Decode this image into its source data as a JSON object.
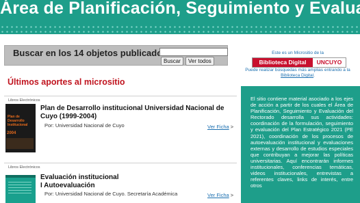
{
  "banner": {
    "title": "Área de Planificación, Seguimiento y Evaluación"
  },
  "search": {
    "label": "Buscar en los 14 objetos publicados:",
    "input_value": "",
    "buscar_button": "Buscar",
    "ver_todos_button": "Ver todos"
  },
  "microsite": {
    "note": "Este es un Micrositio de la",
    "logo_left": "Biblioteca Digital",
    "logo_right": "UNCUYO",
    "search_note_prefix": "Puede realizar búsquedas más amplias entrando a la",
    "search_note_link": "Biblioteca Digital",
    "search_note_suffix": "."
  },
  "section": {
    "title": "Últimos aportes al micrositio"
  },
  "items": [
    {
      "category": "Libros Electrónicos",
      "title_line1": "Plan de Desarrollo institucional Universidad Nacional de",
      "title_line2": "Cuyo (1999-2004)",
      "author": "Por: Universidad Nacional de Cuyo",
      "link": "Ver Ficha",
      "link_arrow": ">",
      "cover_text_1": "Plan de",
      "cover_text_2": "Desarrollo",
      "cover_text_3": "Institucional",
      "cover_year": "2004"
    },
    {
      "category": "Libros Electrónicos",
      "title_line1": "Evaluación institucional",
      "title_line2": "I Autoevaluación",
      "author": "Por: Universidad Nacional de Cuyo. Secretaría Académica",
      "link": "Ver Ficha",
      "link_arrow": ">"
    }
  ],
  "side_panel": {
    "text": "El sitio contiene material asociado a los ejes de acción a partir de los cuales el Área de Planificación, Seguimiento y Evaluación del Rectorado desarrolla sus actividades: coordinación de la formulación, seguimiento y evaluación del Plan Estratégico 2021 (PE 2021), coordinación de los procesos de autoevaluación institucional y evaluaciones externas y desarrollo de estudios especiales que contribuyan a mejorar las políticas universitarias. Aquí encontrarán informes institucionales, conferencias temáticas, videos institucionales, entrevistas a referentes claves, links de interés, entre otros"
  },
  "colors": {
    "accent": "#1e9e8a",
    "section_title": "#c0141f",
    "link": "#1b6fb0",
    "logo_red": "#c8102e"
  }
}
